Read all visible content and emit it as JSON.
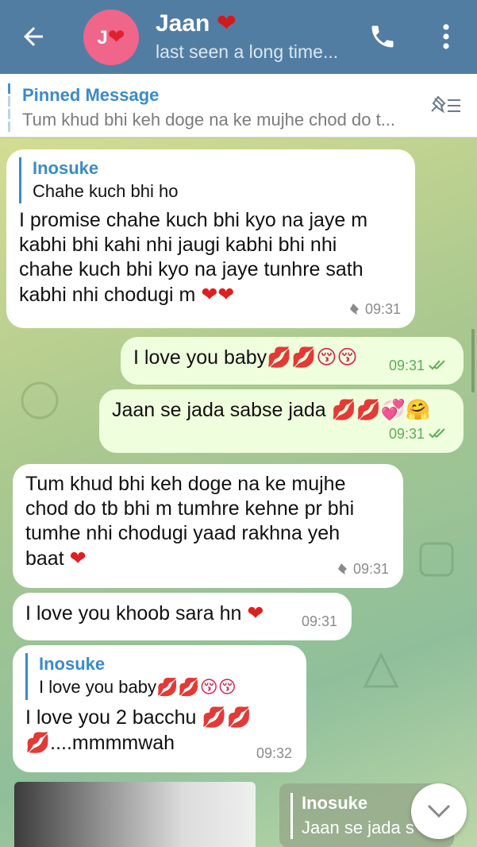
{
  "header": {
    "avatar_letter": "J",
    "avatar_heart": "❤",
    "title": "Jaan",
    "title_heart": "❤",
    "status": "last seen a long time..."
  },
  "pinned": {
    "title": "Pinned Message",
    "text": "Tum khud bhi keh doge na ke mujhe chod do t..."
  },
  "messages": [
    {
      "reply_name": "Inosuke",
      "reply_text": "Chahe kuch bhi ho",
      "text": "I promise chahe kuch bhi kyo na jaye m kabhi bhi kahi nhi jaugi kabhi bhi nhi chahe kuch bhi kyo na jaye tunhre sath kabhi nhi chodugi m",
      "emojis": "❤❤",
      "time": "09:31"
    },
    {
      "text": "I love you baby",
      "emojis": "💋💋😚😚",
      "time": "09:31"
    },
    {
      "text": "Jaan se jada sabse jada",
      "emojis": "💋💋💞🤗",
      "time": "09:31"
    },
    {
      "text": "Tum khud bhi keh doge na ke mujhe chod do tb bhi m tumhre kehne pr bhi tumhe nhi chodugi yaad rakhna yeh baat",
      "emojis": "❤",
      "time": "09:31"
    },
    {
      "text": "I love you khoob sara hn",
      "emojis": "❤",
      "time": "09:31"
    },
    {
      "reply_name": "Inosuke",
      "reply_text": "I love you baby",
      "reply_emojis": "💋💋😚😚",
      "text": "I love you 2 bacchu",
      "emojis": "💋💋💋",
      "text_end": "....mmmmwah",
      "time": "09:32"
    }
  ],
  "bottom_reply": {
    "name": "Inosuke",
    "text": "Jaan se jada s"
  },
  "colors": {
    "header": "#527da3",
    "accent": "#3a8bc9",
    "outgoing_bubble": "#effedd",
    "read_check": "#5fac5a"
  },
  "icons": [
    "back-arrow-icon",
    "call-icon",
    "more-vert-icon",
    "pin-list-icon",
    "pin-icon",
    "double-check-icon",
    "chevron-down-icon"
  ]
}
